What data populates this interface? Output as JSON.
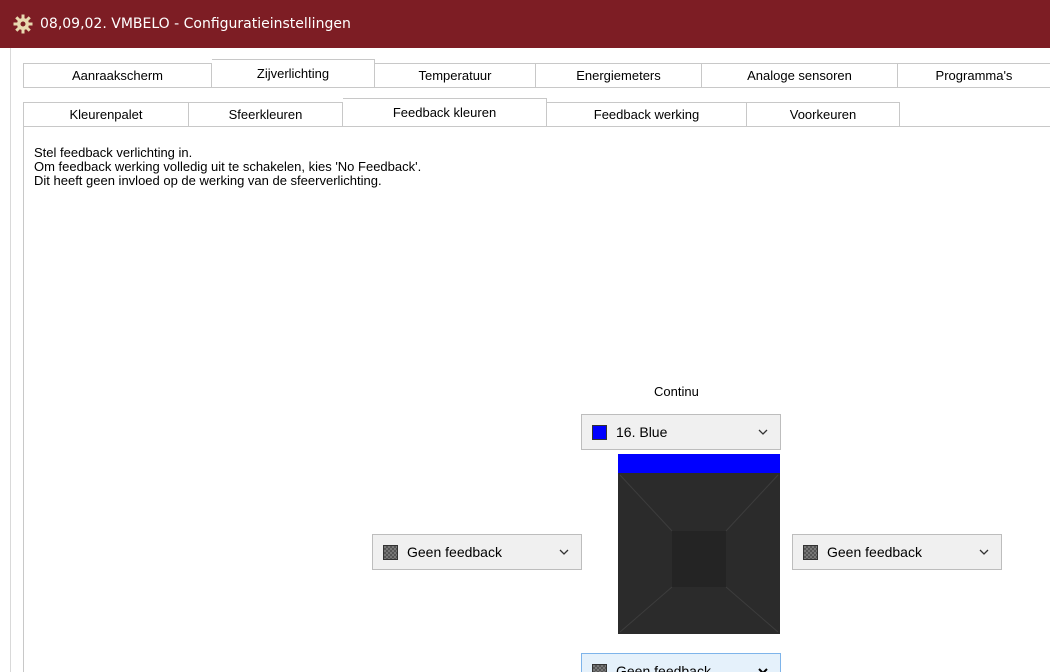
{
  "window": {
    "title": "08,09,02. VMBELO - Configuratieinstellingen"
  },
  "tabs_main": [
    {
      "label": "Aanraakscherm",
      "active": false
    },
    {
      "label": "Zijverlichting",
      "active": true
    },
    {
      "label": "Temperatuur",
      "active": false
    },
    {
      "label": "Energiemeters",
      "active": false
    },
    {
      "label": "Analoge sensoren",
      "active": false
    },
    {
      "label": "Programma's",
      "active": false
    }
  ],
  "tabs_sub": [
    {
      "label": "Kleurenpalet",
      "active": false
    },
    {
      "label": "Sfeerkleuren",
      "active": false
    },
    {
      "label": "Feedback kleuren",
      "active": true
    },
    {
      "label": "Feedback werking",
      "active": false
    },
    {
      "label": "Voorkeuren",
      "active": false
    }
  ],
  "description": [
    "Stel feedback verlichting in.",
    "Om feedback werking volledig uit te schakelen, kies 'No Feedback'.",
    "Dit heeft geen invloed op de werking van de sfeerverlichting."
  ],
  "feedback": {
    "group_label": "Continu",
    "top": {
      "value": "16. Blue",
      "swatch_color": "#0000ff"
    },
    "left": {
      "value": "Geen feedback"
    },
    "right": {
      "value": "Geen feedback"
    },
    "bottom": {
      "value": "Geen feedback"
    }
  },
  "colors": {
    "titlebar": "#7d1d24",
    "accent_blue": "#0000ff",
    "panel": "#2a2a2a"
  }
}
